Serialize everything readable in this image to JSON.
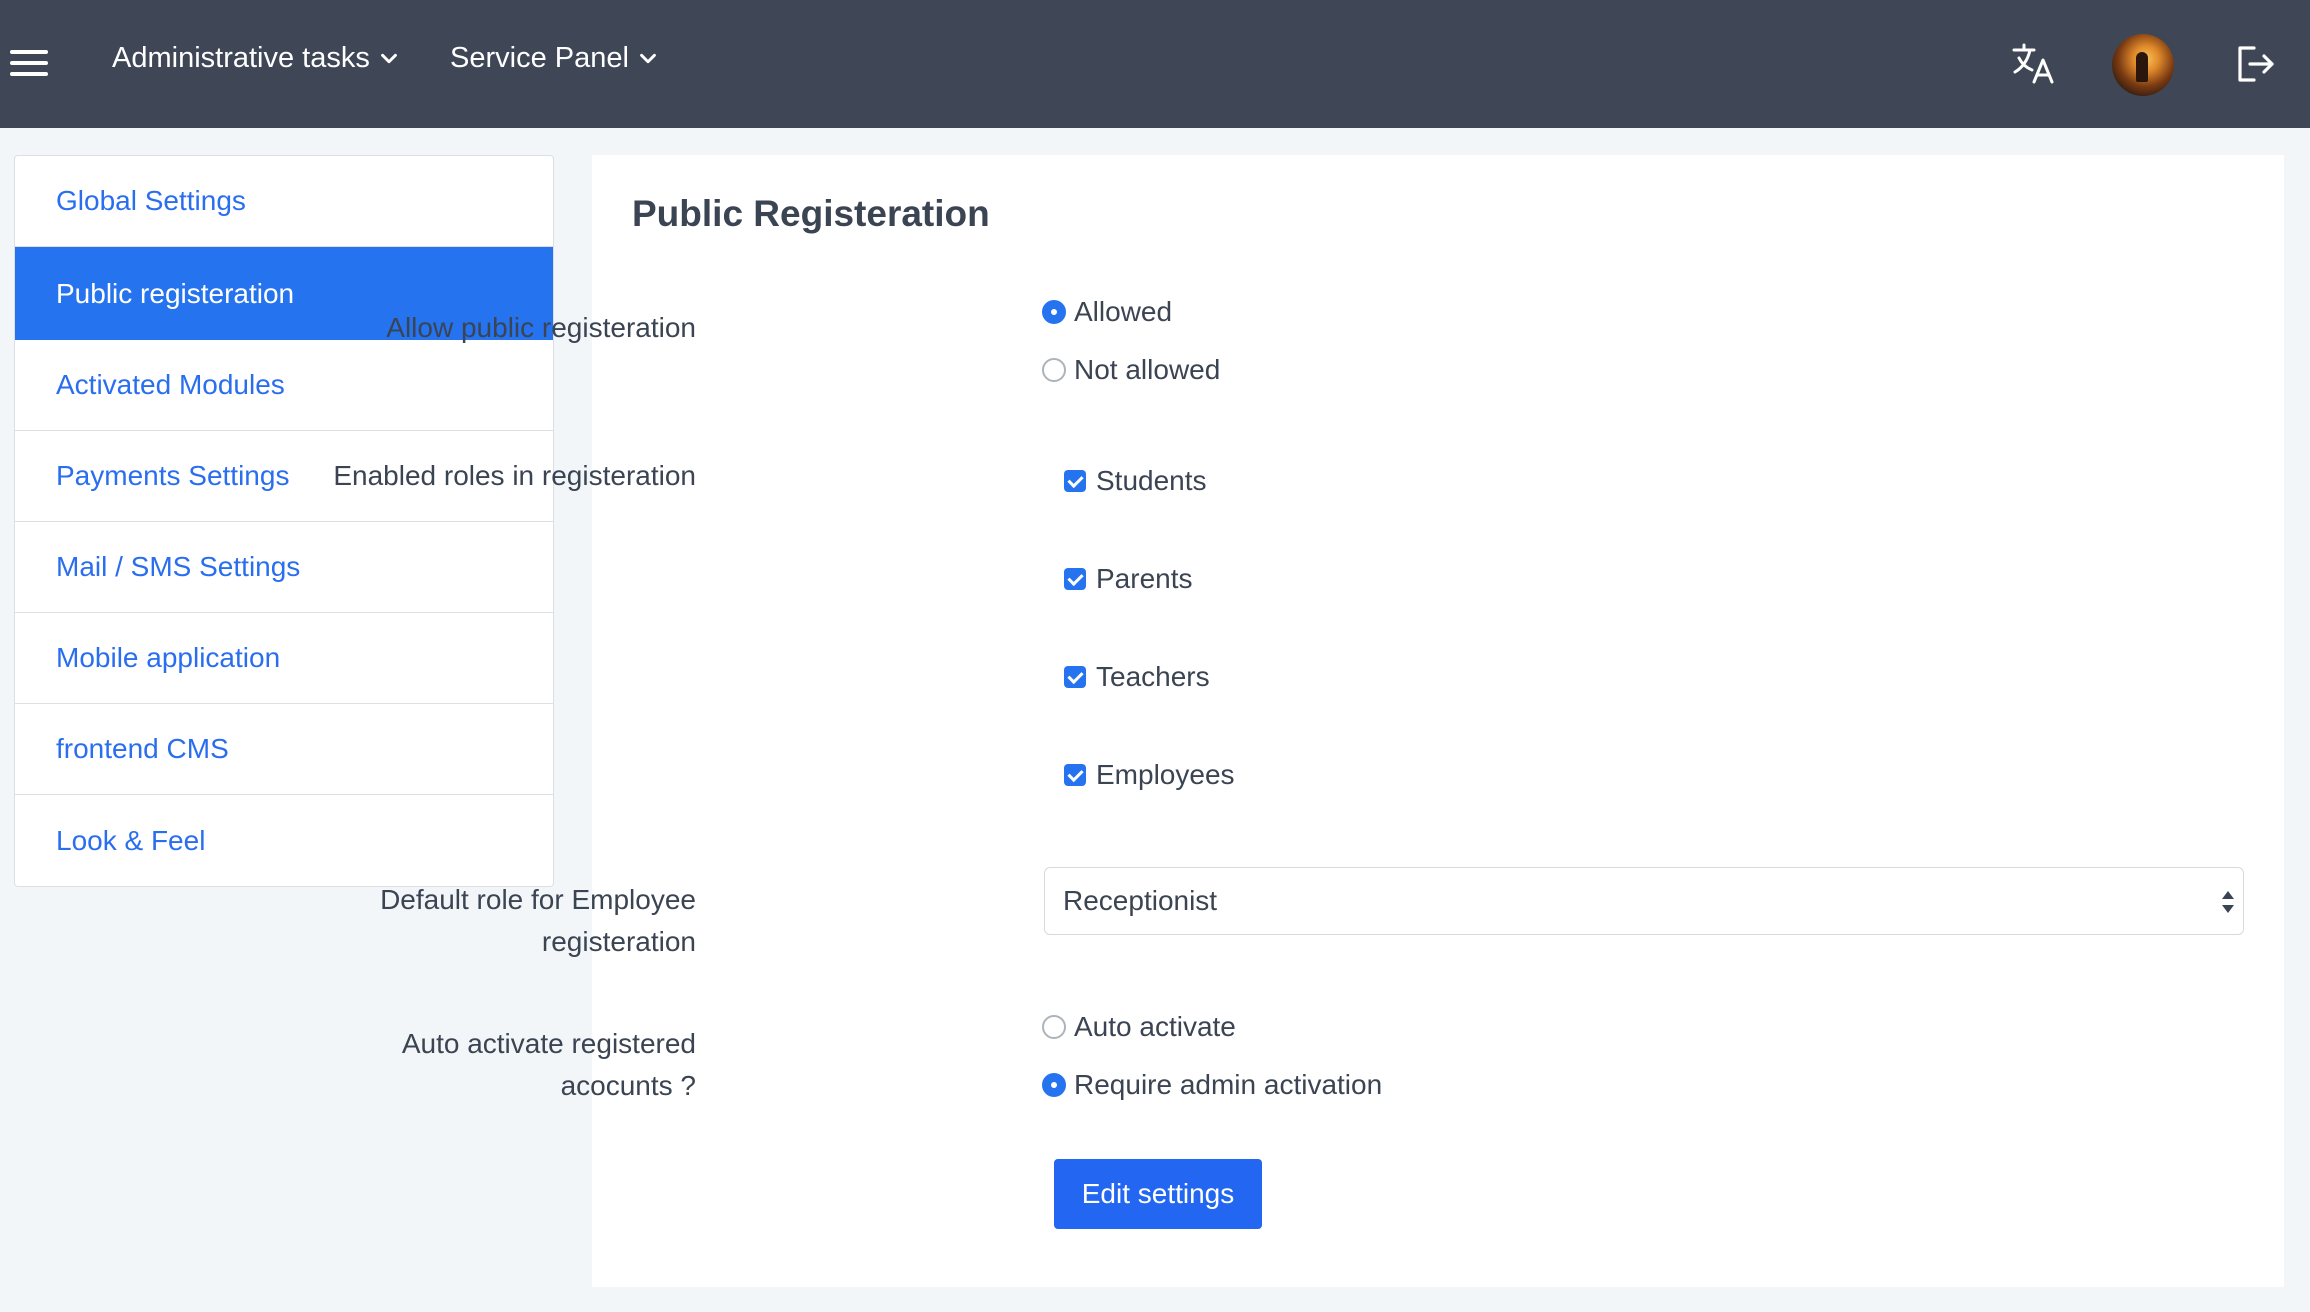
{
  "navbar": {
    "menu_icon": "hamburger-icon",
    "menus": [
      {
        "label": "Administrative tasks",
        "icon": "chevron-down-icon"
      },
      {
        "label": "Service Panel",
        "icon": "chevron-down-icon"
      }
    ],
    "right_icons": [
      "translate-icon",
      "avatar",
      "logout-icon"
    ],
    "background": "#3f4655"
  },
  "sidebar": {
    "items": [
      {
        "label": "Global Settings",
        "active": false
      },
      {
        "label": "Public registeration",
        "active": true
      },
      {
        "label": "Activated Modules",
        "active": false
      },
      {
        "label": "Payments Settings",
        "active": false
      },
      {
        "label": "Mail / SMS Settings",
        "active": false
      },
      {
        "label": "Mobile application",
        "active": false
      },
      {
        "label": "frontend CMS",
        "active": false
      },
      {
        "label": "Look & Feel",
        "active": false
      }
    ],
    "accent": "#2673f0"
  },
  "main": {
    "title": "Public Registeration",
    "allow_public": {
      "label": "Allow public registeration",
      "options": [
        {
          "label": "Allowed",
          "checked": true
        },
        {
          "label": "Not allowed",
          "checked": false
        }
      ]
    },
    "enabled_roles": {
      "label": "Enabled roles in registeration",
      "options": [
        {
          "label": "Students",
          "checked": true
        },
        {
          "label": "Parents",
          "checked": true
        },
        {
          "label": "Teachers",
          "checked": true
        },
        {
          "label": "Employees",
          "checked": true
        }
      ]
    },
    "default_role": {
      "label_line1": "Default role for Employee",
      "label_line2": "registeration",
      "value": "Receptionist"
    },
    "auto_activate": {
      "label_line1": "Auto activate registered",
      "label_line2": "acocunts ?",
      "options": [
        {
          "label": "Auto activate",
          "checked": false
        },
        {
          "label": "Require admin activation",
          "checked": true
        }
      ]
    },
    "edit_button": "Edit settings",
    "button_color": "#2266f2"
  }
}
